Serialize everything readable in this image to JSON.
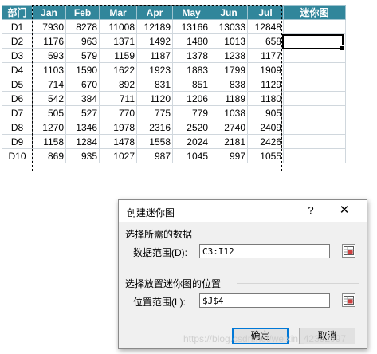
{
  "sheet": {
    "headers": [
      "部门",
      "Jan",
      "Feb",
      "Mar",
      "Apr",
      "May",
      "Jun",
      "Jul",
      "迷你图"
    ],
    "rows": [
      [
        "D1",
        "7930",
        "8278",
        "11008",
        "12189",
        "13166",
        "13033",
        "12848",
        ""
      ],
      [
        "D2",
        "1176",
        "963",
        "1371",
        "1492",
        "1480",
        "1013",
        "658",
        ""
      ],
      [
        "D3",
        "593",
        "579",
        "1159",
        "1187",
        "1378",
        "1238",
        "1177",
        ""
      ],
      [
        "D4",
        "1103",
        "1590",
        "1622",
        "1923",
        "1883",
        "1799",
        "1909",
        ""
      ],
      [
        "D5",
        "714",
        "670",
        "892",
        "831",
        "851",
        "838",
        "1129",
        ""
      ],
      [
        "D6",
        "542",
        "384",
        "711",
        "1120",
        "1206",
        "1189",
        "1180",
        ""
      ],
      [
        "D7",
        "505",
        "527",
        "770",
        "775",
        "779",
        "1038",
        "905",
        ""
      ],
      [
        "D8",
        "1270",
        "1346",
        "1978",
        "2316",
        "2520",
        "2740",
        "2409",
        ""
      ],
      [
        "D9",
        "1158",
        "1284",
        "1478",
        "1558",
        "2024",
        "2181",
        "2426",
        ""
      ],
      [
        "D10",
        "869",
        "935",
        "1027",
        "987",
        "1045",
        "997",
        "1055",
        ""
      ]
    ],
    "header_color": "#31869b"
  },
  "dialog": {
    "title": "创建迷你图",
    "help": "?",
    "close": "✕",
    "section1": "选择所需的数据",
    "data_range_label": "数据范围(D):",
    "data_range_value": "C3:I12",
    "section2": "选择放置迷你图的位置",
    "location_label": "位置范围(L):",
    "location_value": "$J$4",
    "ok": "确定",
    "cancel": "取消"
  },
  "watermark": "https://blog.csdn.net/weixin_42392997"
}
